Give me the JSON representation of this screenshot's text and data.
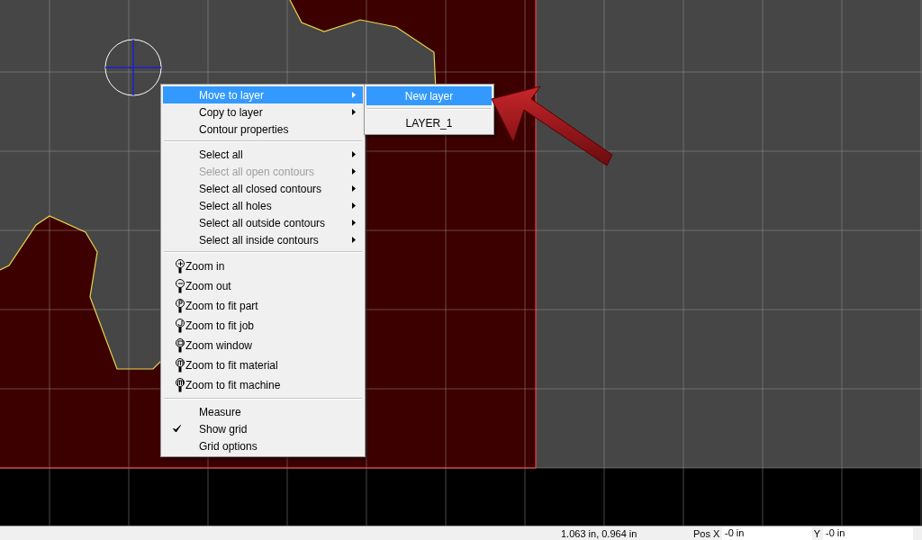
{
  "context_menu": {
    "sections": [
      [
        {
          "kind": "text",
          "label": "Move to layer",
          "submenu": true,
          "disabled": false,
          "selected": true,
          "checked": false
        },
        {
          "kind": "text",
          "label": "Copy to layer",
          "submenu": true,
          "disabled": false,
          "selected": false,
          "checked": false
        },
        {
          "kind": "text",
          "label": "Contour properties",
          "submenu": false,
          "disabled": false,
          "selected": false,
          "checked": false
        }
      ],
      [
        {
          "kind": "text",
          "label": "Select all",
          "submenu": true,
          "disabled": false,
          "selected": false,
          "checked": false
        },
        {
          "kind": "text",
          "label": "Select all open contours",
          "submenu": true,
          "disabled": true,
          "selected": false,
          "checked": false
        },
        {
          "kind": "text",
          "label": "Select all closed contours",
          "submenu": true,
          "disabled": false,
          "selected": false,
          "checked": false
        },
        {
          "kind": "text",
          "label": "Select all holes",
          "submenu": true,
          "disabled": false,
          "selected": false,
          "checked": false
        },
        {
          "kind": "text",
          "label": "Select all outside contours",
          "submenu": true,
          "disabled": false,
          "selected": false,
          "checked": false
        },
        {
          "kind": "text",
          "label": "Select all inside contours",
          "submenu": true,
          "disabled": false,
          "selected": false,
          "checked": false
        }
      ],
      [
        {
          "kind": "zoom",
          "label": "Zoom in",
          "submenu": false,
          "disabled": false,
          "selected": false,
          "checked": false
        },
        {
          "kind": "zoom",
          "label": "Zoom out",
          "submenu": false,
          "disabled": false,
          "selected": false,
          "checked": false
        },
        {
          "kind": "zoom",
          "label": "Zoom to fit part",
          "submenu": false,
          "disabled": false,
          "selected": false,
          "checked": false
        },
        {
          "kind": "zoom",
          "label": "Zoom to fit job",
          "submenu": false,
          "disabled": false,
          "selected": false,
          "checked": false
        },
        {
          "kind": "zoom",
          "label": "Zoom window",
          "submenu": false,
          "disabled": false,
          "selected": false,
          "checked": false
        },
        {
          "kind": "zoom",
          "label": "Zoom to fit material",
          "submenu": false,
          "disabled": false,
          "selected": false,
          "checked": false
        },
        {
          "kind": "zoom",
          "label": "Zoom to fit machine",
          "submenu": false,
          "disabled": false,
          "selected": false,
          "checked": false
        }
      ],
      [
        {
          "kind": "text",
          "label": "Measure",
          "submenu": false,
          "disabled": false,
          "selected": false,
          "checked": false
        },
        {
          "kind": "text",
          "label": "Show grid",
          "submenu": false,
          "disabled": false,
          "selected": false,
          "checked": true
        },
        {
          "kind": "text",
          "label": "Grid options",
          "submenu": false,
          "disabled": false,
          "selected": false,
          "checked": false
        }
      ]
    ]
  },
  "submenu": {
    "sections": [
      [
        {
          "label": "New layer",
          "selected": true
        }
      ],
      [
        {
          "label": "LAYER_1",
          "selected": false
        }
      ]
    ]
  },
  "status_bar": {
    "coordinates": "1.063 in, 0.964 in",
    "pos_x_label": "Pos X",
    "pos_x_value": "-0 in",
    "y_label": "Y",
    "y_value": "-0 in"
  }
}
